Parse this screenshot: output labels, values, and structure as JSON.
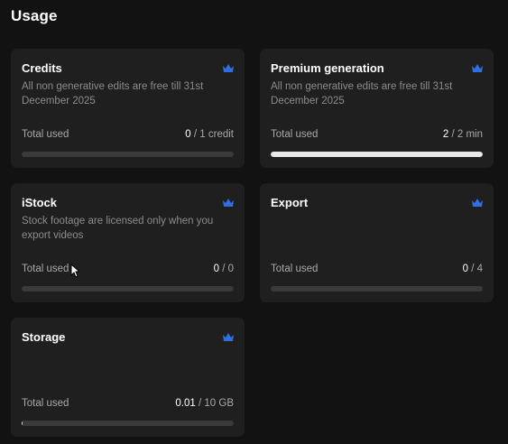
{
  "page": {
    "title": "Usage"
  },
  "cards": [
    {
      "title": "Credits",
      "description": "All non generative edits are free till 31st December 2025",
      "total_label": "Total used",
      "used": "0",
      "limit": " / 1 credit",
      "progress": 0
    },
    {
      "title": "Premium generation",
      "description": "All non generative edits are free till 31st December 2025",
      "total_label": "Total used",
      "used": "2",
      "limit": " / 2 min",
      "progress": 1
    },
    {
      "title": "iStock",
      "description": "Stock footage are licensed only when you export videos",
      "total_label": "Total used",
      "used": "0",
      "limit": " / 0",
      "progress": 0
    },
    {
      "title": "Export",
      "description": "",
      "total_label": "Total used",
      "used": "0",
      "limit": " / 4",
      "progress": 0
    },
    {
      "title": "Storage",
      "description": "",
      "total_label": "Total used",
      "used": "0.01",
      "limit": " / 10 GB",
      "progress": 0.001
    }
  ],
  "icons": {
    "card_badge": "crown-icon",
    "pointer": "mouse-cursor-icon"
  },
  "colors": {
    "background": "#121212",
    "card": "#1f1f1f",
    "crown": "#2f6fe0",
    "bar_track": "#3a3a3a",
    "bar_fill": "#e8e8e8"
  }
}
